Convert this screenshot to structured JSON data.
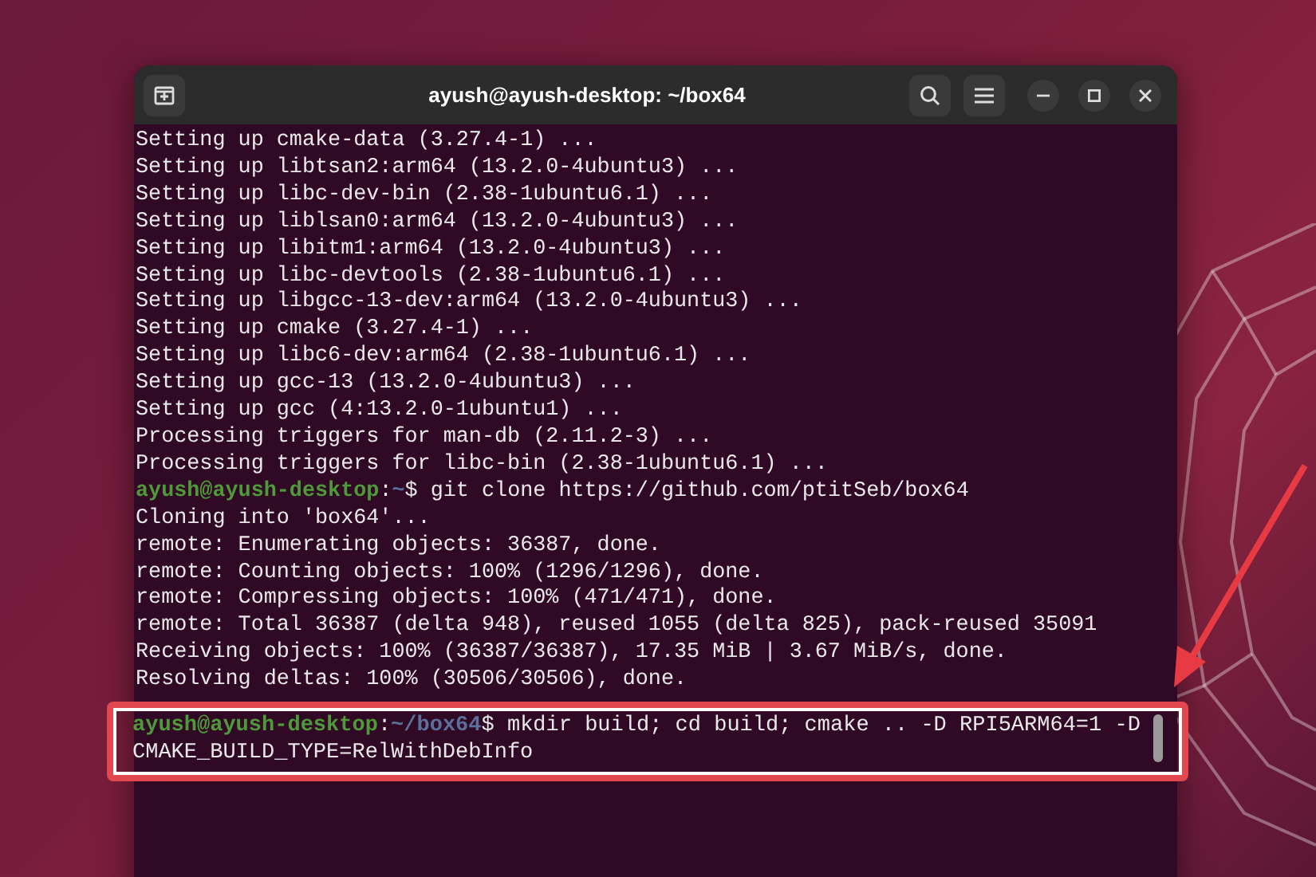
{
  "window": {
    "title": "ayush@ayush-desktop: ~/box64"
  },
  "lines": [
    {
      "kind": "output",
      "text": "Setting up cmake-data (3.27.4-1) ..."
    },
    {
      "kind": "output",
      "text": "Setting up libtsan2:arm64 (13.2.0-4ubuntu3) ..."
    },
    {
      "kind": "output",
      "text": "Setting up libc-dev-bin (2.38-1ubuntu6.1) ..."
    },
    {
      "kind": "output",
      "text": "Setting up liblsan0:arm64 (13.2.0-4ubuntu3) ..."
    },
    {
      "kind": "output",
      "text": "Setting up libitm1:arm64 (13.2.0-4ubuntu3) ..."
    },
    {
      "kind": "output",
      "text": "Setting up libc-devtools (2.38-1ubuntu6.1) ..."
    },
    {
      "kind": "output",
      "text": "Setting up libgcc-13-dev:arm64 (13.2.0-4ubuntu3) ..."
    },
    {
      "kind": "output",
      "text": "Setting up cmake (3.27.4-1) ..."
    },
    {
      "kind": "output",
      "text": "Setting up libc6-dev:arm64 (2.38-1ubuntu6.1) ..."
    },
    {
      "kind": "output",
      "text": "Setting up gcc-13 (13.2.0-4ubuntu3) ..."
    },
    {
      "kind": "output",
      "text": "Setting up gcc (4:13.2.0-1ubuntu1) ..."
    },
    {
      "kind": "output",
      "text": "Processing triggers for man-db (2.11.2-3) ..."
    },
    {
      "kind": "output",
      "text": "Processing triggers for libc-bin (2.38-1ubuntu6.1) ..."
    },
    {
      "kind": "prompt",
      "user": "ayush@ayush-desktop",
      "separator": ":",
      "path": "~",
      "symbol": "$",
      "command": "git clone https://github.com/ptitSeb/box64"
    },
    {
      "kind": "output",
      "text": "Cloning into 'box64'..."
    },
    {
      "kind": "output",
      "text": "remote: Enumerating objects: 36387, done."
    },
    {
      "kind": "output",
      "text": "remote: Counting objects: 100% (1296/1296), done."
    },
    {
      "kind": "output",
      "text": "remote: Compressing objects: 100% (471/471), done."
    },
    {
      "kind": "output",
      "text": "remote: Total 36387 (delta 948), reused 1055 (delta 825), pack-reused 35091"
    },
    {
      "kind": "output",
      "text": "Receiving objects: 100% (36387/36387), 17.35 MiB | 3.67 MiB/s, done."
    },
    {
      "kind": "output",
      "text": "Resolving deltas: 100% (30506/30506), done."
    }
  ],
  "highlighted": {
    "kind": "prompt",
    "user": "ayush@ayush-desktop",
    "separator": ":",
    "path": "~/box64",
    "symbol": "$",
    "command": "mkdir build; cd build; cmake .. -D RPI5ARM64=1 -D CMAKE_BUILD_TYPE=RelWithDebInfo"
  }
}
